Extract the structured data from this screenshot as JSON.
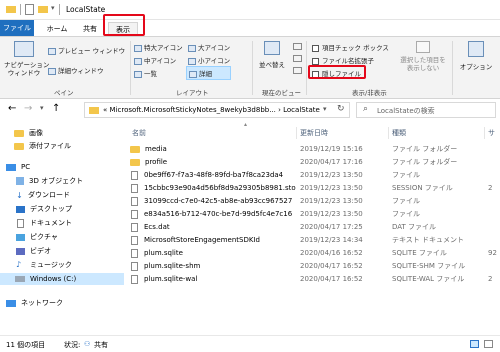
{
  "window": {
    "title": "LocalState"
  },
  "tabs": {
    "file": "ファイル",
    "home": "ホーム",
    "share": "共有",
    "view": "表示"
  },
  "ribbon": {
    "nav_pane": "ナビゲーション\nウィンドウ",
    "preview_pane": "プレビュー ウィンドウ",
    "details_pane": "詳細ウィンドウ",
    "pane_label": "ペイン",
    "xl_icons": "特大アイコン",
    "l_icons": "大アイコン",
    "m_icons": "中アイコン",
    "s_icons": "小アイコン",
    "list": "一覧",
    "details": "詳細",
    "layout_label": "レイアウト",
    "sort": "並べ替え",
    "current_view_label": "現在のビュー",
    "item_checkbox": "項目チェック ボックス",
    "file_ext": "ファイル名拡張子",
    "hidden_files": "隠しファイル",
    "hide_selected": "選択した項目を\n表示しない",
    "show_hide_label": "表示/非表示",
    "options": "オプション"
  },
  "address": {
    "path": "«  Microsoft.MicrosoftStickyNotes_8wekyb3d8bb...  ›  LocalState",
    "search_placeholder": "LocalStateの検索"
  },
  "nav": [
    {
      "label": "画像",
      "icon": "folder"
    },
    {
      "label": "添付ファイル",
      "icon": "folder"
    },
    {
      "label": "PC",
      "icon": "pc"
    },
    {
      "label": "3D オブジェクト",
      "icon": "cube"
    },
    {
      "label": "ダウンロード",
      "icon": "download"
    },
    {
      "label": "デスクトップ",
      "icon": "desktop"
    },
    {
      "label": "ドキュメント",
      "icon": "document"
    },
    {
      "label": "ピクチャ",
      "icon": "picture"
    },
    {
      "label": "ビデオ",
      "icon": "video"
    },
    {
      "label": "ミュージック",
      "icon": "music"
    },
    {
      "label": "Windows (C:)",
      "icon": "drive"
    },
    {
      "label": "ネットワーク",
      "icon": "network"
    }
  ],
  "columns": {
    "name": "名前",
    "date": "更新日時",
    "type": "種類",
    "size": "サ"
  },
  "files": [
    {
      "name": "media",
      "date": "2019/12/19 15:16",
      "type": "ファイル フォルダー",
      "size": "",
      "icon": "folder"
    },
    {
      "name": "profile",
      "date": "2020/04/17 17:16",
      "type": "ファイル フォルダー",
      "size": "",
      "icon": "folder"
    },
    {
      "name": "0be9ff67-f7a3-48f8-89fd-ba7f8ca23da4",
      "date": "2019/12/23 13:50",
      "type": "ファイル",
      "size": "",
      "icon": "file"
    },
    {
      "name": "15cbbc93e90a4d56bf8d9a29305b8981.sto...",
      "date": "2019/12/23 13:50",
      "type": "SESSION ファイル",
      "size": "2",
      "icon": "file"
    },
    {
      "name": "31099ccd-c7e0-42c5-ab8e-ab93cc967527",
      "date": "2019/12/23 13:50",
      "type": "ファイル",
      "size": "",
      "icon": "file"
    },
    {
      "name": "e834a516-b712-470c-be7d-99d5fc4e7c16",
      "date": "2019/12/23 13:50",
      "type": "ファイル",
      "size": "",
      "icon": "file"
    },
    {
      "name": "Ecs.dat",
      "date": "2020/04/17 17:25",
      "type": "DAT ファイル",
      "size": "",
      "icon": "file"
    },
    {
      "name": "MicrosoftStoreEngagementSDKId",
      "date": "2019/12/23 14:34",
      "type": "テキスト ドキュメント",
      "size": "",
      "icon": "file"
    },
    {
      "name": "plum.sqlite",
      "date": "2020/04/16 16:52",
      "type": "SQLITE ファイル",
      "size": "92",
      "icon": "file"
    },
    {
      "name": "plum.sqlite-shm",
      "date": "2020/04/17 16:52",
      "type": "SQLITE-SHM ファイル",
      "size": "",
      "icon": "file"
    },
    {
      "name": "plum.sqlite-wal",
      "date": "2020/04/17 16:52",
      "type": "SQLITE-WAL ファイル",
      "size": "2",
      "icon": "file"
    }
  ],
  "status": {
    "count": "11 個の項目",
    "state_label": "状況:",
    "state_value": "共有"
  },
  "colors": {
    "accent": "#1f6fbf",
    "highlight": "#e4081a",
    "selected": "#cce8ff",
    "folder": "#f3c64b"
  }
}
